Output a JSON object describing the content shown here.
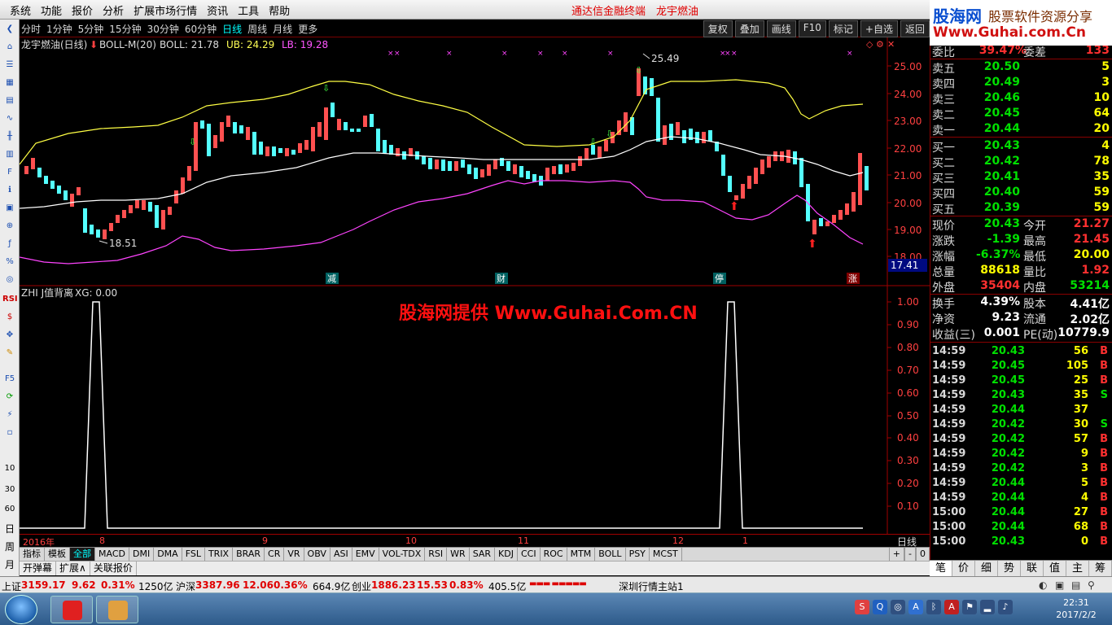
{
  "menu": [
    "系统",
    "功能",
    "报价",
    "分析",
    "扩展市场行情",
    "资讯",
    "工具",
    "帮助"
  ],
  "window_title": "通达信金融终端　龙宇燃油",
  "brand": {
    "name": "股海网",
    "slogan": "股票软件资源分享",
    "url": "Www.Guhai.com.Cn"
  },
  "periods": [
    "分时",
    "1分钟",
    "5分钟",
    "15分钟",
    "30分钟",
    "60分钟",
    "日线",
    "周线",
    "月线",
    "更多"
  ],
  "selected_period": "日线",
  "tools": [
    "复权",
    "叠加",
    "画线",
    "F10",
    "标记",
    "+自选",
    "返回"
  ],
  "main_chart": {
    "title": "龙宇燃油(日线)",
    "indicator": "BOLL-M(20)",
    "boll": "BOLL: 21.78",
    "ub": "UB: 24.29",
    "lb": "LB: 19.28",
    "high_mark": "25.49",
    "low_mark": "18.51",
    "current_price": "17.41",
    "y_ticks": [
      "25.00",
      "24.00",
      "23.00",
      "22.00",
      "21.00",
      "20.00",
      "19.00",
      "18.00"
    ],
    "signals": [
      "减",
      "财",
      "停",
      "涨"
    ]
  },
  "sub_chart": {
    "title": "ZHI J值背离",
    "xg": "XG: 0.00",
    "y_ticks": [
      "1.00",
      "0.90",
      "0.80",
      "0.70",
      "0.60",
      "0.50",
      "0.40",
      "0.30",
      "0.20",
      "0.10"
    ],
    "watermark": "股海网提供 Www.Guhai.Com.CN"
  },
  "chart_data": [
    {
      "type": "line",
      "title": "",
      "series": [
        {
          "name": "XG",
          "values": [
            0,
            1,
            0,
            0,
            1,
            0
          ]
        }
      ],
      "ylim": [
        0,
        1
      ]
    }
  ],
  "x_axis": {
    "labels": [
      "2016年",
      "8",
      "9",
      "10",
      "11",
      "12",
      "1"
    ],
    "mode": "日线"
  },
  "indicator_tabs": [
    "指标",
    "模板",
    "全部",
    "MACD",
    "DMI",
    "DMA",
    "FSL",
    "TRIX",
    "BRAR",
    "CR",
    "VR",
    "OBV",
    "ASI",
    "EMV",
    "VOL-TDX",
    "RSI",
    "WR",
    "SAR",
    "KDJ",
    "CCI",
    "ROC",
    "MTM",
    "BOLL",
    "PSY",
    "MCST"
  ],
  "indicator_tab_selected": "全部",
  "plus_minus": [
    "+",
    "-",
    "0"
  ],
  "sub_tabs": [
    "开弹幕",
    "扩展∧",
    "关联报价"
  ],
  "quote": {
    "weibi": {
      "label": "委比",
      "value": "39.47%",
      "label2": "委差",
      "value2": "133"
    },
    "sells": [
      {
        "label": "卖五",
        "price": "20.50",
        "vol": "5"
      },
      {
        "label": "卖四",
        "price": "20.49",
        "vol": "3"
      },
      {
        "label": "卖三",
        "price": "20.46",
        "vol": "10"
      },
      {
        "label": "卖二",
        "price": "20.45",
        "vol": "64"
      },
      {
        "label": "卖一",
        "price": "20.44",
        "vol": "20"
      }
    ],
    "buys": [
      {
        "label": "买一",
        "price": "20.43",
        "vol": "4"
      },
      {
        "label": "买二",
        "price": "20.42",
        "vol": "78"
      },
      {
        "label": "买三",
        "price": "20.41",
        "vol": "35"
      },
      {
        "label": "买四",
        "price": "20.40",
        "vol": "59"
      },
      {
        "label": "买五",
        "price": "20.39",
        "vol": "59"
      }
    ],
    "stats": [
      {
        "l1": "现价",
        "v1": "20.43",
        "l2": "今开",
        "v2": "21.27"
      },
      {
        "l1": "涨跌",
        "v1": "-1.39",
        "l2": "最高",
        "v2": "21.45"
      },
      {
        "l1": "涨幅",
        "v1": "-6.37%",
        "l2": "最低",
        "v2": "20.00"
      },
      {
        "l1": "总量",
        "v1": "88618",
        "l2": "量比",
        "v2": "1.92"
      },
      {
        "l1": "外盘",
        "v1": "35404",
        "l2": "内盘",
        "v2": "53214"
      }
    ],
    "fund": [
      {
        "l1": "换手",
        "v1": "4.39%",
        "l2": "股本",
        "v2": "4.41亿"
      },
      {
        "l1": "净资",
        "v1": "9.23",
        "l2": "流通",
        "v2": "2.02亿"
      },
      {
        "l1": "收益(三)",
        "v1": "0.001",
        "l2": "PE(动)",
        "v2": "10779.9"
      }
    ],
    "ticks": [
      {
        "t": "14:59",
        "p": "20.43",
        "q": "56",
        "d": "B"
      },
      {
        "t": "14:59",
        "p": "20.45",
        "q": "105",
        "d": "B"
      },
      {
        "t": "14:59",
        "p": "20.45",
        "q": "25",
        "d": "B"
      },
      {
        "t": "14:59",
        "p": "20.43",
        "q": "35",
        "d": "S"
      },
      {
        "t": "14:59",
        "p": "20.44",
        "q": "37",
        "d": ""
      },
      {
        "t": "14:59",
        "p": "20.42",
        "q": "30",
        "d": "S"
      },
      {
        "t": "14:59",
        "p": "20.42",
        "q": "57",
        "d": "B"
      },
      {
        "t": "14:59",
        "p": "20.42",
        "q": "9",
        "d": "B"
      },
      {
        "t": "14:59",
        "p": "20.42",
        "q": "3",
        "d": "B"
      },
      {
        "t": "14:59",
        "p": "20.44",
        "q": "5",
        "d": "B"
      },
      {
        "t": "14:59",
        "p": "20.44",
        "q": "4",
        "d": "B"
      },
      {
        "t": "15:00",
        "p": "20.44",
        "q": "27",
        "d": "B"
      },
      {
        "t": "15:00",
        "p": "20.44",
        "q": "68",
        "d": "B"
      },
      {
        "t": "15:00",
        "p": "20.43",
        "q": "0",
        "d": "B"
      }
    ],
    "tabs": [
      "笔",
      "价",
      "细",
      "势",
      "联",
      "值",
      "主",
      "筹"
    ]
  },
  "status": {
    "sh_label": "上证",
    "sh_index": "3159.17",
    "sh_chg": "9.62",
    "sh_pct": "0.31%",
    "sh_amt": "1250亿",
    "sz_label": "沪深",
    "sz_index": "3387.96",
    "sz_chg": "12.06",
    "sz_pct": "0.36%",
    "sz_amt": "664.9亿",
    "cy_label": "创业",
    "cy_index": "1886.23",
    "cy_chg": "15.53",
    "cy_pct": "0.83%",
    "cy_amt": "405.5亿",
    "server": "深圳行情主站1"
  },
  "clock": {
    "time": "22:31",
    "date": "2017/2/2"
  },
  "left_icons": [
    "RSI",
    "10",
    "30",
    "60",
    "日",
    "周",
    "月"
  ]
}
